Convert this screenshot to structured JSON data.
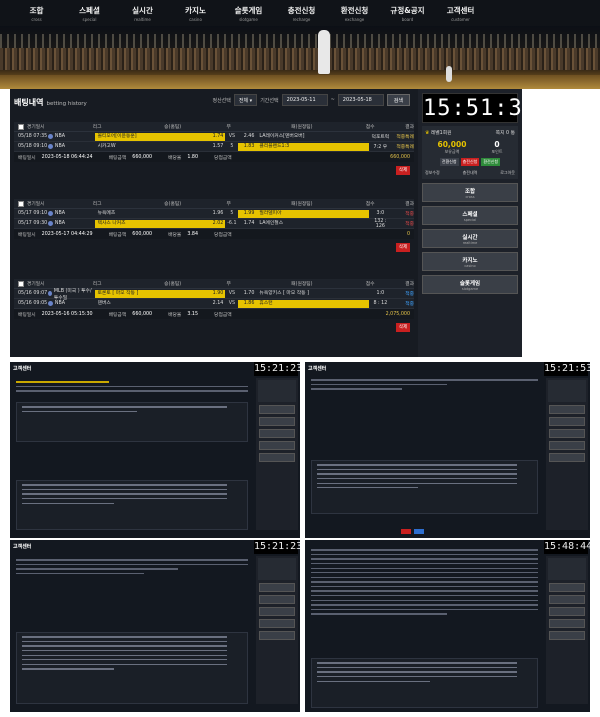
{
  "nav": [
    {
      "ko": "조합",
      "en": "cross"
    },
    {
      "ko": "스페셜",
      "en": "special"
    },
    {
      "ko": "실시간",
      "en": "realtime"
    },
    {
      "ko": "카지노",
      "en": "casino"
    },
    {
      "ko": "슬롯게임",
      "en": "slotgame"
    },
    {
      "ko": "충전신청",
      "en": "recharge"
    },
    {
      "ko": "환전신청",
      "en": "exchange"
    },
    {
      "ko": "규정&공지",
      "en": "board"
    },
    {
      "ko": "고객센터",
      "en": "customer"
    }
  ],
  "page": {
    "title": "배팅내역",
    "subtitle": "betting history"
  },
  "filters": {
    "status_label": "정산선택",
    "status_value": "전체",
    "period_label": "기간선택",
    "from": "2023-05-11",
    "to": "2023-05-18",
    "search": "검색"
  },
  "cols": [
    "경기일시",
    "리그",
    "승(홈팀)",
    "무",
    "패(원정팀)",
    "점수",
    "결과"
  ],
  "foot_keys": {
    "bet_time": "배팅일시",
    "bet_amount": "배팅금액",
    "odds": "배당율",
    "win_amount": "당첨금액"
  },
  "delete_label": "삭제",
  "bets": [
    {
      "rows": [
        {
          "time": "05/18 07:35",
          "league": "NBA",
          "home": "볼티모어[이윤동훈]",
          "home_odds": "1.74",
          "mid": "VS",
          "away_odds": "2.46",
          "away": "LA레이커스[덴버오버]",
          "score": "덕포트럭",
          "result": "적중특례"
        },
        {
          "time": "05/18 09:10",
          "league": "NBA",
          "home": "시카고W",
          "home_odds": "1.57",
          "mid": "5",
          "away_odds": "1.83",
          "away": "클리블랜드1:3",
          "score": "7:2 우",
          "result": "적중특례"
        }
      ],
      "bet_time": "2023-05-18 06:44:24",
      "bet_amount": "660,000",
      "odds": "1.80",
      "win_amount": "",
      "payout": "660,000",
      "payout_class": ""
    },
    {
      "rows": [
        {
          "time": "05/17 09:10",
          "league": "NBA",
          "home": "뉴욕메츠",
          "home_odds": "1.96",
          "mid": "5",
          "away_odds": "1.99",
          "away": "필라델피아",
          "score": "3:0",
          "result": "적중"
        },
        {
          "time": "05/17 09:30",
          "league": "NBA",
          "home": "텍사스 나커츠",
          "home_odds": "2.02",
          "mid": "-6.1",
          "away_odds": "1.74",
          "away": "LA에인절스",
          "score": "132 : 126",
          "result": "적중"
        }
      ],
      "bet_time": "2023-05-17 04:44:29",
      "bet_amount": "600,000",
      "odds": "3.84",
      "win_amount": "",
      "payout": "0",
      "payout_class": "lose"
    },
    {
      "rows": [
        {
          "time": "05/16 09:07",
          "league": "MLB (미국 ) 투수/투수밀",
          "home": "토론토 [ 마모 작동 ]",
          "home_odds": "1.90",
          "mid": "VS",
          "away_odds": "1.70",
          "away": "뉴욕양키스 [ 마모 작동 ]",
          "score": "1:0",
          "result": "적중"
        },
        {
          "time": "05/16 09:05",
          "league": "NBA",
          "home": "덴버스",
          "home_odds": "2.14",
          "mid": "VS",
          "away_odds": "1.86",
          "away": "휴스턴",
          "score": "8 : 12",
          "result": "적중"
        }
      ],
      "bet_time": "2023-05-16 05:15:30",
      "bet_amount": "660,000",
      "odds": "3.15",
      "win_amount": "",
      "payout": "2,075,000",
      "payout_class": "gold"
    }
  ],
  "side": {
    "clock": "15:51:38",
    "user_label": "레벨1회원",
    "user_right": "쪽지 0 통",
    "money": "60,000",
    "money_label": "보유금액",
    "point": "0",
    "point_label": "포인트",
    "btn_transfer": "전환신청",
    "btn_charge": "충전신청",
    "btn_exchange": "환전신청",
    "link1": "정보수정",
    "link2": "충전내역",
    "link3": "로그아웃",
    "menu": [
      {
        "ko": "조합",
        "en": "cross"
      },
      {
        "ko": "스페셜",
        "en": "special"
      },
      {
        "ko": "실시간",
        "en": "realtime"
      },
      {
        "ko": "카지노",
        "en": "casino"
      },
      {
        "ko": "슬롯게임",
        "en": "slotgame"
      }
    ]
  },
  "thumbs": [
    {
      "clock": "15:21:23",
      "title": "고객센터"
    },
    {
      "clock": "15:21:53",
      "title": "고객센터"
    },
    {
      "clock": "15:21:23",
      "title": "고객센터"
    },
    {
      "clock": "15:48:44",
      "title": ""
    }
  ],
  "colors": {
    "accent": "#e6c300",
    "danger": "#c92020",
    "win": "#3ea2ff",
    "bg": "#171b22"
  }
}
